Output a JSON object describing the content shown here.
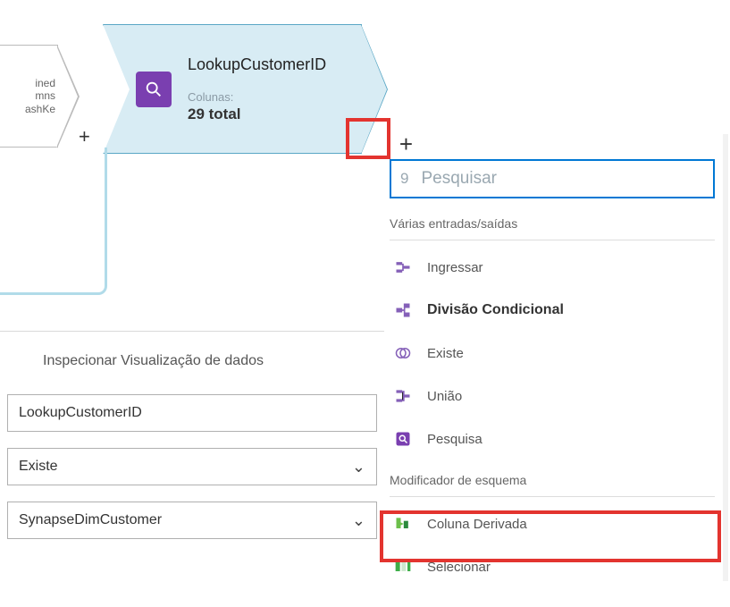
{
  "partial_node": {
    "line1": "ined",
    "line2": "mns",
    "line3": "ashKe"
  },
  "node": {
    "title": "LookupCustomerID",
    "sublabel": "Colunas:",
    "count": "29 total"
  },
  "tabs": {
    "inspect": "Inspecionar",
    "viz": "Visualização de dados"
  },
  "form": {
    "name_value": "LookupCustomerID",
    "exists_value": "Existe",
    "source_value": "SynapseDimCustomer"
  },
  "popup": {
    "search_prefix": "9",
    "search_placeholder": "Pesquisar",
    "section_multi": "Várias entradas/saídas",
    "items_multi": {
      "join": "Ingressar",
      "split": "Divisão Condicional",
      "exists": "Existe",
      "union": "União",
      "lookup": "Pesquisa"
    },
    "section_schema": "Modificador de esquema",
    "items_schema": {
      "derived": "Coluna Derivada",
      "select": "Selecionar"
    }
  },
  "colors": {
    "accent": "#0078d4",
    "node_bg": "#d8ecf4",
    "node_border": "#5aa7c5",
    "highlight": "#e3342f",
    "purple": "#7a3fb0"
  }
}
